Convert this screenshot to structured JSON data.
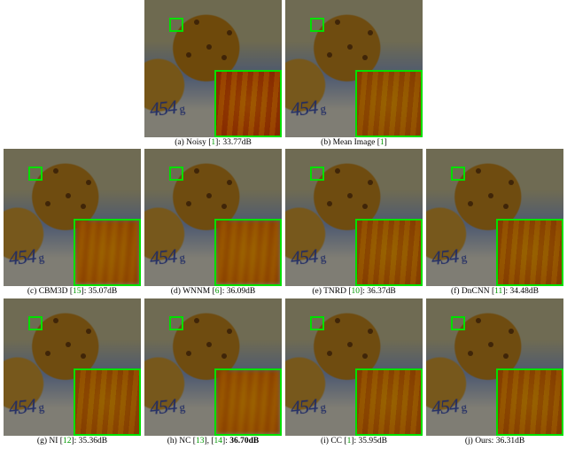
{
  "figure": {
    "rows": [
      [
        {
          "key": "a",
          "letter": "(a)",
          "method": "Noisy",
          "refs": [
            "1"
          ],
          "db": "33.77dB",
          "bold": false,
          "inset": "noisy"
        },
        {
          "key": "b",
          "letter": "(b)",
          "method": "Mean Image",
          "refs": [
            "1"
          ],
          "db": "",
          "bold": false,
          "inset": "normal"
        }
      ],
      [
        {
          "key": "c",
          "letter": "(c)",
          "method": "CBM3D",
          "refs": [
            "15"
          ],
          "db": "35.07dB",
          "bold": false,
          "inset": "blurry"
        },
        {
          "key": "d",
          "letter": "(d)",
          "method": "WNNM",
          "refs": [
            "6"
          ],
          "db": "36.09dB",
          "bold": false,
          "inset": "blurry"
        },
        {
          "key": "e",
          "letter": "(e)",
          "method": "TNRD",
          "refs": [
            "10"
          ],
          "db": "36.37dB",
          "bold": false,
          "inset": "normal"
        },
        {
          "key": "f",
          "letter": "(f)",
          "method": "DnCNN",
          "refs": [
            "11"
          ],
          "db": "34.48dB",
          "bold": false,
          "inset": "normal"
        }
      ],
      [
        {
          "key": "g",
          "letter": "(g)",
          "method": "NI",
          "refs": [
            "12"
          ],
          "db": "35.36dB",
          "bold": false,
          "inset": "normal"
        },
        {
          "key": "h",
          "letter": "(h)",
          "method": "NC",
          "refs": [
            "13",
            "14"
          ],
          "db": "36.70dB",
          "bold": true,
          "inset": "blurry"
        },
        {
          "key": "i",
          "letter": "(i)",
          "method": "CC",
          "refs": [
            "1"
          ],
          "db": "35.95dB",
          "bold": false,
          "inset": "normal"
        },
        {
          "key": "j",
          "letter": "(j)",
          "method": "Ours",
          "refs": [],
          "db": "36.31dB",
          "bold": false,
          "inset": "normal"
        }
      ]
    ],
    "weight_text": "454",
    "weight_unit": "g"
  }
}
